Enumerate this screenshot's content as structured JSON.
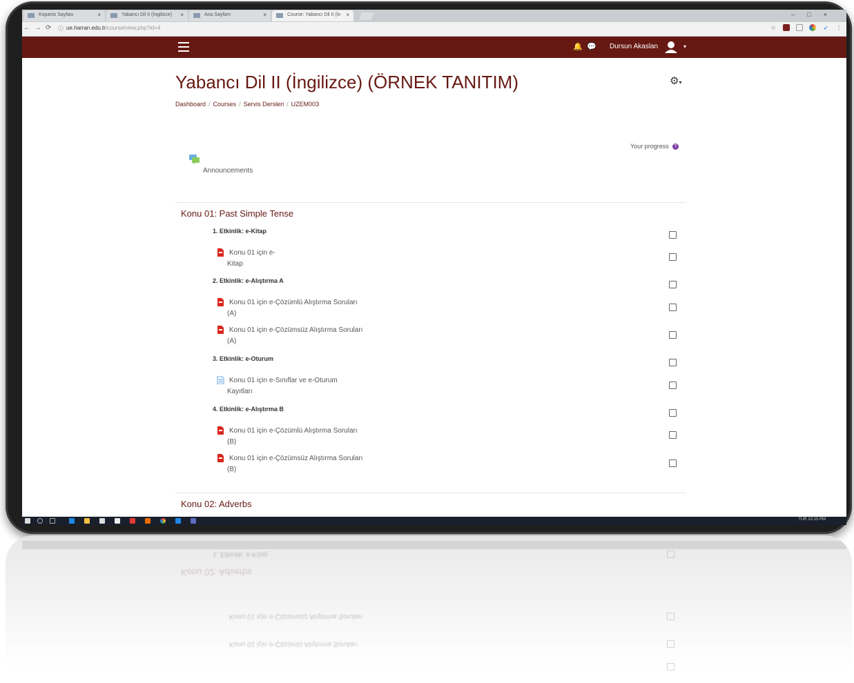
{
  "browser": {
    "tabs": [
      {
        "label": "Kopanis Sayfası"
      },
      {
        "label": "Yabancı Dil II (İngilizce)"
      },
      {
        "label": "Ana Sayfam"
      },
      {
        "label": "Course: Yabancı Dil II (İn"
      }
    ],
    "tab_close": "×",
    "url_host": "ue.harran.edu.tr",
    "url_path": "/course/view.php?id=4"
  },
  "navbar": {
    "user_name": "Dursun Akaslan",
    "caret": "▾",
    "bell": "🔔",
    "chat": "💬"
  },
  "page": {
    "title": "Yabancı Dil II (İngilizce) (ÖRNEK TANITIM)",
    "settings_caret": "▾",
    "breadcrumb": [
      "Dashboard",
      "Courses",
      "Servis Dersleri",
      "UZEM003"
    ],
    "breadcrumb_sep": "/",
    "progress_label": "Your progress",
    "progress_help": "?",
    "announcements": "Announcements"
  },
  "sections": [
    {
      "title": "Konu 01: Past Simple Tense",
      "label1": "1. Etkinlik: e-Kitap",
      "a1": {
        "l1": "Konu 01 için e-",
        "l2": "Kitap"
      },
      "label2": "2. Etkinlik: e-Alıştırma A",
      "a2": {
        "l1": "Konu 01 için e-Çözümlü Alıştırma Soruları",
        "l2": "(A)"
      },
      "a3": {
        "l1": "Konu 01 için e-Çözümsüz Alıştırma Soruları",
        "l2": "(A)"
      },
      "label3": "3. Etkinlik: e-Oturum",
      "a4": {
        "l1": "Konu 01 için e-Sınıflar ve e-Oturum",
        "l2": "Kayıtları"
      },
      "label4": "4. Etkinlik: e-Alıştırma B",
      "a5": {
        "l1": "Konu 01 için e-Çözümlü Alıştırma Soruları",
        "l2": "(B)"
      },
      "a6": {
        "l1": "Konu 01 için e-Çözümsüz Alıştırma Soruları",
        "l2": "(B)"
      }
    },
    {
      "title": "Konu 02: Adverbs",
      "label1": "1. Etkinlik: e-Kitap"
    }
  ],
  "taskbar": {
    "clock": "TUR  10:15 PM"
  },
  "colors": {
    "brand": "#661912",
    "pdf_icon": "#d9261c",
    "help_icon": "#7b3fa0"
  }
}
